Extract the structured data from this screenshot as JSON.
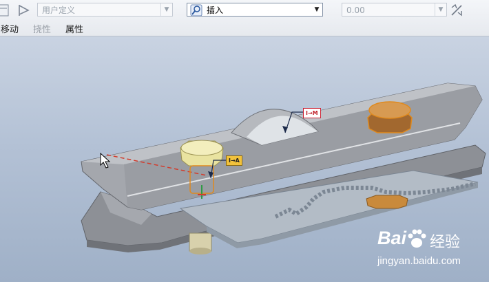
{
  "toolbar": {
    "view_type_combo": {
      "value": "用户定义",
      "disabled": true
    },
    "constraint_combo": {
      "value": "插入"
    },
    "offset_combo": {
      "value": "0.00",
      "disabled": true
    }
  },
  "menu": {
    "move_label": "移动",
    "flex_label": "挠性",
    "properties_label": "属性"
  },
  "viewport": {
    "tag_center": "I→M",
    "tag_left": "I→A"
  },
  "watermark": {
    "brand_left": "Bai",
    "brand_right": "经验",
    "url": "jingyan.baidu.com"
  },
  "colors": {
    "selection_orange": "#e08a1e",
    "highlight_yellow": "#e9e3a0",
    "part_gray": "#9ea2a8",
    "brand_blue": "#2f6fd6"
  },
  "icons": [
    "window-icon",
    "flag-icon",
    "constraint-insert-icon",
    "swap-direction-icon",
    "cursor-icon",
    "paw-icon"
  ]
}
